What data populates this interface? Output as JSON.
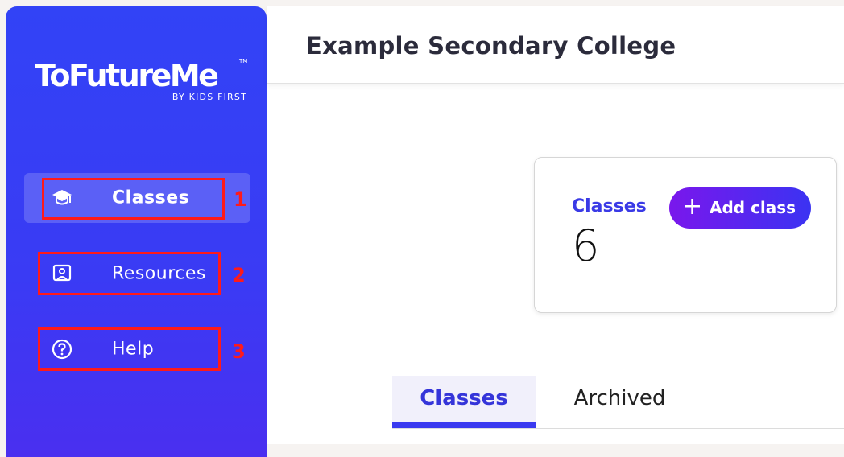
{
  "app": {
    "logo_text": "ToFutureMe",
    "logo_tm": "TM",
    "logo_sub": "BY KIDS FIRST"
  },
  "sidebar": {
    "items": [
      {
        "label": "Classes",
        "icon": "graduation-cap-icon",
        "active": true,
        "marker": "1"
      },
      {
        "label": "Resources",
        "icon": "presentation-icon",
        "active": false,
        "marker": "2"
      },
      {
        "label": "Help",
        "icon": "question-circle-icon",
        "active": false,
        "marker": "3"
      }
    ]
  },
  "header": {
    "title": "Example Secondary College"
  },
  "summary_card": {
    "label": "Classes",
    "count": "6",
    "add_button": {
      "icon": "plus-icon",
      "label": "Add class"
    }
  },
  "tabs": [
    {
      "label": "Classes",
      "active": true
    },
    {
      "label": "Archived",
      "active": false
    }
  ],
  "colors": {
    "sidebar_gradient_start": "#3243f6",
    "sidebar_gradient_end": "#4a2ff0",
    "accent": "#3a3ae6",
    "button_gradient_start": "#7a17ec",
    "button_gradient_end": "#3b33f2",
    "annotation_red": "#ff1a1a"
  }
}
